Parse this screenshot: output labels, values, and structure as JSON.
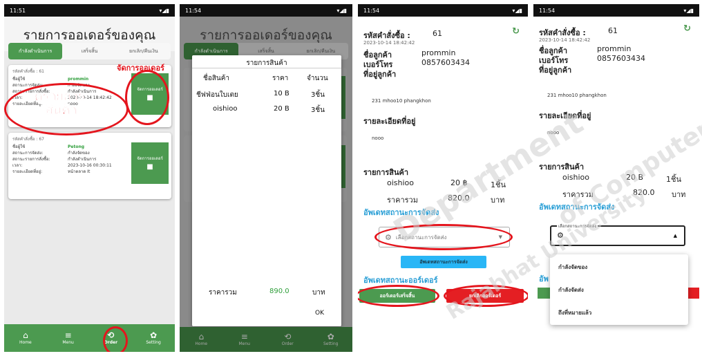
{
  "colors": {
    "accent_green": "#4c9a50",
    "annotation_red": "#e4151d",
    "link_cyan": "#2a9fd6",
    "danger_red": "#e41f23",
    "cyan_button": "#29b6f6"
  },
  "p1": {
    "time": "11:51",
    "title": "รายการออเดอร์ของคุณ",
    "tabs": [
      "กำลังดำเนินการ",
      "เสร็จสิ้น",
      "ยกเลิก/คืนเงิน"
    ],
    "order1": {
      "id_line": "รหัสคำสั่งซื้อ : 61",
      "name_label": "ชื่อผู้ใช้",
      "name_value": "prommin",
      "status_label": "สถานะการจัดส่ง:",
      "status_value": "กำลังจัดของ",
      "order_status_label": "สถานะรายการสั่งซื้อ:",
      "order_status_value": "กำลังดำเนินการ",
      "time_label": "เวลา:",
      "time_value": "2023-10-14 18:42:42",
      "address_label": "รายละเอียดที่อยู่:",
      "address_value": "nooo",
      "button": "จัดการออเดอร์"
    },
    "order2": {
      "id_line": "รหัสคำสั่งซื้อ : 67",
      "name_label": "ชื่อผู้ใช้",
      "name_value": "Petong",
      "status_label": "สถานะการจัดส่ง:",
      "status_value": "กำลังจัดของ",
      "order_status_label": "สถานะรายการสั่งซื้อ:",
      "order_status_value": "กำลังดำเนินการ",
      "time_label": "เวลา:",
      "time_value": "2023-10-16 00:30:11",
      "address_label": "รายละเอียดที่อยู่:",
      "address_value": "หน้าตลาด It",
      "button": "จัดการออเดอร์"
    },
    "annot_manage": "จัดการออเดอร์",
    "annot_list_1": "ดูรายการ",
    "annot_list_2": "สินค้า",
    "nav": [
      "Home",
      "Menu",
      "Order",
      "Setting"
    ]
  },
  "p2": {
    "time": "11:54",
    "title": "รายการออเดอร์ของคุณ",
    "tabs": [
      "กำลังดำเนินการ",
      "เสร็จสิ้น",
      "ยกเลิก/คืนเงิน"
    ],
    "dialog_title": "รายการสินค้า",
    "col_name": "ชื่อสินค้า",
    "col_price": "ราคา",
    "col_qty": "จำนวน",
    "rows": [
      {
        "name": "ชีฟฟ่อนใบเตย",
        "price": "10 B",
        "qty": "3ชิ้น"
      },
      {
        "name": "oishioo",
        "price": "20 B",
        "qty": "3ชิ้น"
      }
    ],
    "total_label": "ราคารวม",
    "total_value": "890.0",
    "total_unit": "บาท",
    "ok": "OK",
    "nav": [
      "Home",
      "Menu",
      "Order",
      "Setting"
    ]
  },
  "p3": {
    "time": "11:54",
    "order_id_label": "รหัสคำสั่งซื้อ :",
    "order_id": "61",
    "date": "2023-10-14 18:42:42",
    "customer_label": "ชื่อลูกค้า",
    "customer": "prommin",
    "phone_label": "เบอร์โทร",
    "phone": "0857603434",
    "address_label": "ที่อยู่ลูกค้า",
    "address": "231 mhoo10 phangkhon",
    "detail_label": "รายละเอียดที่อยู่",
    "detail": "nooo",
    "items_label": "รายการสินค้า",
    "item": {
      "name": "oishioo",
      "price": "20 ฿",
      "qty": "1ชิ้น"
    },
    "total_label": "ราคารวม",
    "total_value": "820.0",
    "total_unit": "บาท",
    "update_ship_label": "อัพเดทสถานะการจัดส่ง",
    "dropdown_placeholder": "เลือกสถานะการจัดส่ง",
    "update_ship_button": "อัพเดทสถานะการจัดส่ง",
    "update_order_label": "อัพเดทสถานะออร์เดอร์",
    "complete_button": "ออร์เดอร์เสร็จสิ้น",
    "cancel_button": "ยกเลิกออร์เดอร์"
  },
  "p4": {
    "time": "11:54",
    "order_id_label": "รหัสคำสั่งซื้อ :",
    "order_id": "61",
    "date": "2023-10-14 18:42:42",
    "customer_label": "ชื่อลูกค้า",
    "customer": "prommin",
    "phone_label": "เบอร์โทร",
    "phone": "0857603434",
    "address_label": "ที่อยู่ลูกค้า",
    "address": "231 mhoo10 phangkhon",
    "detail_label": "รายละเอียดที่อยู่",
    "detail": "nooo",
    "items_label": "รายการสินค้า",
    "item": {
      "name": "oishioo",
      "price": "20 B",
      "qty": "1ชิ้น"
    },
    "total_label": "ราคารวม",
    "total_value": "820.0",
    "total_unit": "บาท",
    "update_ship_label": "อัพเดทสถานะการจัดส่ง",
    "dropdown_float_label": "เลือกสถานะการจัดส่ง",
    "options": [
      "กำลังจัดของ",
      "กำลังจัดส่ง",
      "ถึงที่หมายแล้ว"
    ],
    "update_order_label_partial": "อัพ"
  },
  "watermark": [
    "Department",
    "of Computer",
    "Rajabhat University"
  ]
}
